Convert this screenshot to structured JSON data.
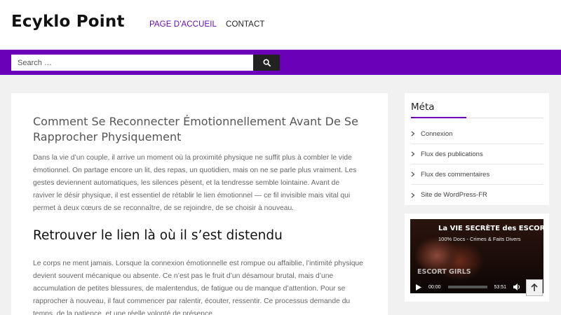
{
  "header": {
    "site_title": "Ecyklo Point",
    "nav": [
      {
        "label": "PAGE D'ACCUEIL",
        "active": true
      },
      {
        "label": "CONTACT",
        "active": false
      }
    ]
  },
  "search": {
    "placeholder": "Search …",
    "button_icon": "search-icon"
  },
  "post": {
    "title": "Comment Se Reconnecter Émotionnellement Avant De Se Rapprocher Physiquement",
    "intro": "Dans la vie d’un couple, il arrive un moment où la proximité physique ne suffit plus à combler le vide émotionnel. On partage encore un lit, des repas, un quotidien, mais on ne se parle plus vraiment. Les gestes deviennent automatiques, les silences pèsent, et la tendresse semble lointaine. Avant de raviver le désir physique, il est essentiel de rétablir le lien émotionnel — ce fil invisible mais vital qui permet à deux cœurs de se reconnaître, de se rejoindre, de se choisir à nouveau.",
    "heading": "Retrouver le lien là où il s’est distendu",
    "body": "Le corps ne ment jamais. Lorsque la connexion émotionnelle est rompue ou affaiblie, l’intimité physique devient souvent mécanique ou absente. Ce n’est pas le fruit d’un désamour brutal, mais d’une accumulation de petites blessures, de malentendus, de fatigue ou de manque d’attention. Pour se rapprocher à nouveau, il faut commencer par ralentir, écouter, ressentir. Ce processus demande du temps, de la patience, et une réelle volonté de présence."
  },
  "sidebar": {
    "meta_title": "Méta",
    "meta_items": [
      "Connexion",
      "Flux des publications",
      "Flux des commentaires",
      "Site de WordPress-FR"
    ]
  },
  "video": {
    "title": "La VIE SECRÈTE des ESCOR",
    "subtitle": "100% Docs - Crimes & Faits Divers",
    "overlay_text": "ESCORT GIRLS",
    "current_time": "00:00",
    "duration": "53:51",
    "progress": 0
  },
  "colors": {
    "accent": "#6a00b8",
    "nav_active": "#6a0dad"
  }
}
